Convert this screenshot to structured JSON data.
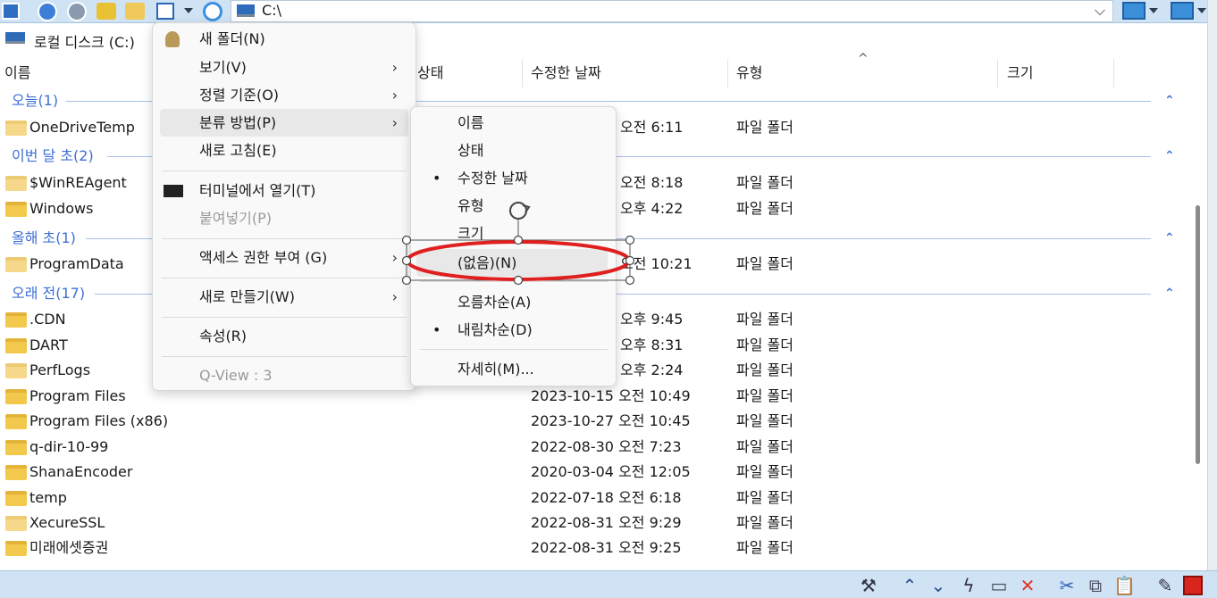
{
  "toolbar": {
    "address": "C:\\",
    "icons": [
      "panel-icon",
      "back-icon",
      "forward-icon",
      "up-folder-icon",
      "new-folder-icon",
      "view-mode-icon",
      "refresh-icon",
      "drive-icon"
    ]
  },
  "location": {
    "label": "로컬 디스크 (C:)"
  },
  "columns": {
    "name": "이름",
    "status": "상태",
    "modified": "수정한 날짜",
    "type": "유형",
    "size": "크기"
  },
  "groups": [
    {
      "label": "오늘(1)"
    },
    {
      "label": "이번 달 초(2)"
    },
    {
      "label": "올해 초(1)"
    },
    {
      "label": "오래 전(17)"
    }
  ],
  "rows": [
    {
      "name": "OneDriveTemp",
      "date": "오전 6:11",
      "type": "파일 폴더"
    },
    {
      "name": "$WinREAgent",
      "date": "오전 8:18",
      "type": "파일 폴더"
    },
    {
      "name": "Windows",
      "date": "오후 4:22",
      "type": "파일 폴더"
    },
    {
      "name": "ProgramData",
      "date": "오전 10:21",
      "type": "파일 폴더"
    },
    {
      "name": ".CDN",
      "date": "오후 9:45",
      "type": "파일 폴더"
    },
    {
      "name": "DART",
      "date": "오후 8:31",
      "type": "파일 폴더"
    },
    {
      "name": "PerfLogs",
      "date": "오후 2:24",
      "type": "파일 폴더"
    },
    {
      "name": "Program Files",
      "date": "2023-10-15 오전 10:49",
      "type": "파일 폴더"
    },
    {
      "name": "Program Files (x86)",
      "date": "2023-10-27 오전 10:45",
      "type": "파일 폴더"
    },
    {
      "name": "q-dir-10-99",
      "date": "2022-08-30 오전 7:23",
      "type": "파일 폴더"
    },
    {
      "name": "ShanaEncoder",
      "date": "2020-03-04 오전 12:05",
      "type": "파일 폴더"
    },
    {
      "name": "temp",
      "date": "2022-07-18 오전 6:18",
      "type": "파일 폴더"
    },
    {
      "name": "XecureSSL",
      "date": "2022-08-31 오전 9:29",
      "type": "파일 폴더"
    },
    {
      "name": "미래에셋증권",
      "date": "2022-08-31 오전 9:25",
      "type": "파일 폴더"
    }
  ],
  "context_menu": {
    "new_folder": "새 폴더(N)",
    "view": "보기(V)",
    "sort_by": "정렬 기준(O)",
    "group_by": "분류 방법(P)",
    "refresh": "새로 고침(E)",
    "open_terminal": "터미널에서 열기(T)",
    "paste": "붙여넣기(P)",
    "grant_access": "액세스 권한 부여 (G)",
    "new": "새로 만들기(W)",
    "properties": "속성(R)",
    "qview": "Q-View : 3",
    "arrow": "›"
  },
  "submenu": {
    "name": "이름",
    "status": "상태",
    "modified": "수정한 날짜",
    "type": "유형",
    "size": "크기",
    "none": "(없음)(N)",
    "ascending": "오름차순(A)",
    "descending": "내림차순(D)",
    "more": "자세히(M)...",
    "bullet": "•"
  },
  "colors": {
    "accent": "#3e6fd4",
    "toolbar": "#cfe3f5",
    "highlight_ellipse": "#e01f1f",
    "folder": "#f2c94c"
  }
}
